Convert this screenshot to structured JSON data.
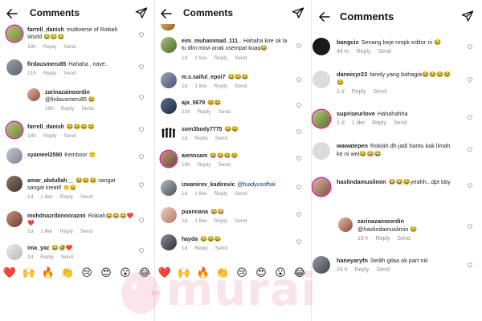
{
  "screen1": {
    "title": "Comments",
    "comments": [
      {
        "user": "farrell_danish",
        "text": "multiverse of Rokiah World 😂😂😂",
        "time": "18h",
        "likes": "",
        "reply": "Reply",
        "send": "Send"
      },
      {
        "user": "firdausmeru85",
        "text": "Hahaha , naye..",
        "time": "21h",
        "likes": "",
        "reply": "Reply",
        "send": "Send"
      },
      {
        "user": "zarinazainoordin",
        "text": "@firdausmeru85 😂",
        "time": "19h",
        "likes": "",
        "reply": "Reply",
        "send": "Send"
      },
      {
        "user": "farrell_danish",
        "text": "😂😂😂😂",
        "time": "18h",
        "likes": "",
        "reply": "Reply",
        "send": "Send"
      },
      {
        "user": "syameel2590",
        "text": "Kemboor 🙂",
        "time": "",
        "likes": "",
        "reply": "",
        "send": ""
      },
      {
        "user": "amar_abdullah__",
        "text": "😂😂😂 sangat sangat kreatif 👏😄",
        "time": "1d",
        "likes": "1 like",
        "reply": "Reply",
        "send": "Send"
      },
      {
        "user": "mohdnazribinnorazmi",
        "text": "Rokiah😂😂😂❤️❤️",
        "time": "1d",
        "likes": "1 like",
        "reply": "Reply",
        "send": "Send"
      },
      {
        "user": "ima_yaz",
        "text": "😂🤣❤️",
        "time": "1d",
        "likes": "",
        "reply": "Reply",
        "send": "Send"
      }
    ]
  },
  "screen2": {
    "title": "Comments",
    "comments": [
      {
        "user": "eim_muhammad_111_",
        "text": "Hahaha kire ok la tu dlm movi anak xsempat kuaq😂",
        "time": "1d",
        "likes": "1 like",
        "reply": "Reply",
        "send": "Send"
      },
      {
        "user": "m.s.saiful_epoi7",
        "text": "😂😂😂",
        "time": "1d",
        "likes": "1 like",
        "reply": "Reply",
        "send": "Send"
      },
      {
        "user": "aja_5679",
        "text": "😂😂",
        "time": "23h",
        "likes": "",
        "reply": "Reply",
        "send": "Send"
      },
      {
        "user": "som3body7775",
        "text": "😂😂",
        "time": "1d",
        "likes": "",
        "reply": "Reply",
        "send": "Send"
      },
      {
        "user": "aiennsam",
        "text": "😂😂😂😂",
        "time": "18h",
        "likes": "",
        "reply": "Reply",
        "send": "Send"
      },
      {
        "user": "izwanirov_kadirovic",
        "text": "@fuadyusoffviii",
        "time": "1d",
        "likes": "1 like",
        "reply": "Reply",
        "send": "Send"
      },
      {
        "user": "puannana",
        "text": "😂😂",
        "time": "1d",
        "likes": "1 like",
        "reply": "Reply",
        "send": "Send"
      },
      {
        "user": "hayda",
        "text": "😂😂😂",
        "time": "1d",
        "likes": "",
        "reply": "Reply",
        "send": "Send"
      }
    ]
  },
  "screen3": {
    "title": "Comments",
    "comments": [
      {
        "user": "bangcix",
        "text": "Senang keje nmpk editor ni 😂",
        "time": "46 m",
        "likes": "",
        "reply": "Reply",
        "send": "Send"
      },
      {
        "user": "darwisyr23",
        "text": "family yang bahagia😂😂😂😂😂",
        "time": "1 d",
        "likes": "",
        "reply": "Reply",
        "send": "Send"
      },
      {
        "user": "supriseurlove",
        "text": "Hahahahha",
        "time": "1 d",
        "likes": "1 like",
        "reply": "Reply",
        "send": "Send"
      },
      {
        "user": "wawatepen",
        "text": "Rokiah dh jadi hantu kak limah ke ni wei😂😂😂",
        "time": "1 d",
        "likes": "",
        "reply": "Reply",
        "send": "Send"
      },
      {
        "user": "haslindamuslimin",
        "text": "😂😂😂yeahh...dpt bby",
        "time": "1 d",
        "likes": "",
        "reply": "Reply",
        "send": "Send"
      },
      {
        "user": "zarinazainoordin",
        "text": "@haslindamuslimin 😂",
        "time": "19 h",
        "likes": "",
        "reply": "Reply",
        "send": "Send"
      },
      {
        "user": "haneyaryfn",
        "text": "Sedih gilaa ok part niii",
        "time": "24 h",
        "likes": "",
        "reply": "Reply",
        "send": "Send"
      }
    ]
  },
  "reactions": [
    "❤️",
    "🙌",
    "🔥",
    "👏",
    "😢",
    "😍",
    "😮",
    "😂",
    "❤️",
    "🙌",
    "🔥",
    "👏",
    "😢",
    "😍",
    "😮",
    "😂"
  ],
  "watermark": {
    "text": "murai"
  },
  "colors": {
    "text": "#262626",
    "meta": "#8e8e8e",
    "story_ring": "#d6249f",
    "background": "#ffffff"
  }
}
